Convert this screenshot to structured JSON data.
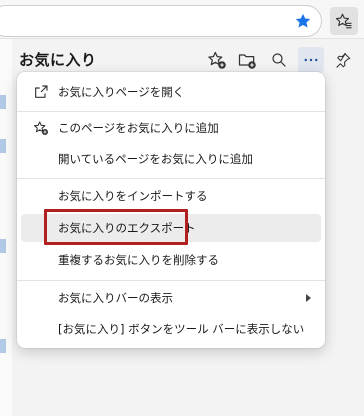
{
  "toolbar": {
    "star_icon": "star-filled-icon",
    "favorites_icon": "favorites-star-icon"
  },
  "pane": {
    "title": "お気に入り",
    "icons": [
      "add-favorite-icon",
      "add-folder-icon",
      "search-icon",
      "more-options-icon",
      "pin-icon"
    ]
  },
  "menu": {
    "items": [
      {
        "label": "お気に入りページを開く",
        "icon": "open-external-icon"
      },
      {
        "label": "このページをお気に入りに追加",
        "icon": "star-add-icon"
      },
      {
        "label": "開いているページをお気に入りに追加",
        "icon": ""
      },
      {
        "label": "お気に入りをインポートする",
        "icon": ""
      },
      {
        "label": "お気に入りのエクスポート",
        "icon": ""
      },
      {
        "label": "重複するお気に入りを削除する",
        "icon": ""
      },
      {
        "label": "お気に入りバーの表示",
        "icon": "chevron-right-icon"
      },
      {
        "label": "[お気に入り] ボタンをツール バーに表示しない",
        "icon": ""
      }
    ],
    "hovered_item": "お気に入りのエクスポート"
  },
  "colors": {
    "accent_blue": "#1a73e8",
    "highlight_red": "#b0201f",
    "hover_bg": "#ececec"
  }
}
